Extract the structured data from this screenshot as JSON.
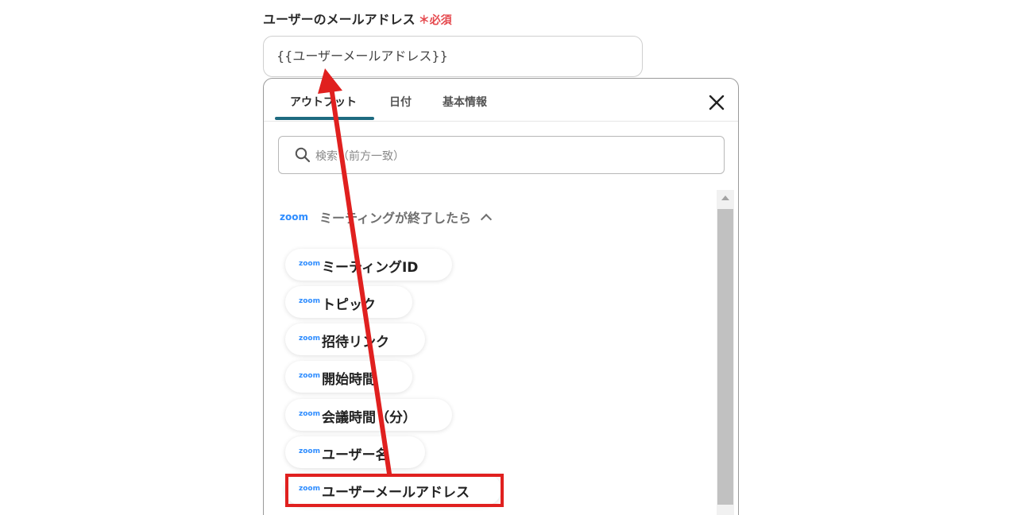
{
  "field": {
    "label": "ユーザーのメールアドレス",
    "required_mark": "＊",
    "required_text": "必須",
    "value": "{{ユーザーメールアドレス}}"
  },
  "tabs": [
    {
      "label": "アウトプット",
      "active": true
    },
    {
      "label": "日付",
      "active": false
    },
    {
      "label": "基本情報",
      "active": false
    }
  ],
  "search": {
    "placeholder": "検索（前方一致）"
  },
  "group": {
    "logo": "zoom",
    "title": "ミーティングが終了したら"
  },
  "items": [
    {
      "logo": "zoom",
      "label": "ミーティングID"
    },
    {
      "logo": "zoom",
      "label": "トピック"
    },
    {
      "logo": "zoom",
      "label": "招待リンク"
    },
    {
      "logo": "zoom",
      "label": "開始時間"
    },
    {
      "logo": "zoom",
      "label": "会議時間（分）"
    },
    {
      "logo": "zoom",
      "label": "ユーザー名"
    },
    {
      "logo": "zoom",
      "label": "ユーザーメールアドレス"
    }
  ],
  "annotation": {
    "color": "#e0201f"
  },
  "colors": {
    "accent": "#1e6a80",
    "required": "#e5484d",
    "zoom": "#2d8cff"
  },
  "icons": {
    "close": "close-icon",
    "search": "search-icon",
    "chevron": "chevron-up-icon"
  }
}
